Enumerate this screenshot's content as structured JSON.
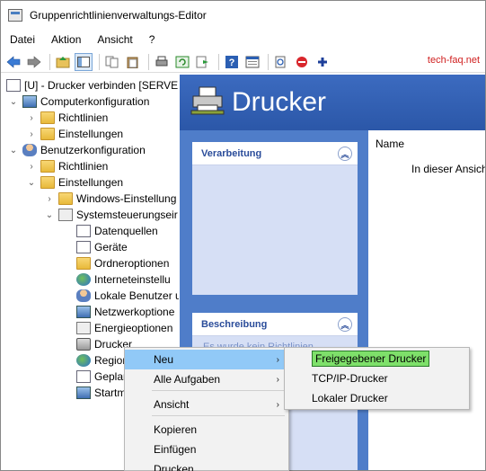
{
  "window": {
    "title": "Gruppenrichtlinienverwaltungs-Editor"
  },
  "menu": [
    "Datei",
    "Aktion",
    "Ansicht",
    "?"
  ],
  "toolbar": {
    "icons": [
      "back-arrow-icon",
      "forward-arrow-icon",
      "up-folder-icon",
      "show-hide-tree-icon",
      "copy-icon",
      "paste-icon",
      "print-icon",
      "refresh-icon",
      "export-icon",
      "help-icon",
      "properties-icon",
      "new-item-icon",
      "delete-icon",
      "add-icon"
    ],
    "watermark": "tech-faq.net"
  },
  "tree": {
    "items": [
      {
        "label": "[U] - Drucker verbinden [SERVER",
        "icon": "policy-doc-icon",
        "indent": 0,
        "chevron": ""
      },
      {
        "label": "Computerkonfiguration",
        "icon": "computer-config-icon",
        "indent": 1,
        "chevron": "open"
      },
      {
        "label": "Richtlinien",
        "icon": "folder-icon",
        "indent": 2,
        "chevron": "closed"
      },
      {
        "label": "Einstellungen",
        "icon": "folder-icon",
        "indent": 2,
        "chevron": "closed"
      },
      {
        "label": "Benutzerkonfiguration",
        "icon": "user-config-icon",
        "indent": 1,
        "chevron": "open"
      },
      {
        "label": "Richtlinien",
        "icon": "folder-icon",
        "indent": 2,
        "chevron": "closed"
      },
      {
        "label": "Einstellungen",
        "icon": "folder-icon",
        "indent": 2,
        "chevron": "open"
      },
      {
        "label": "Windows-Einstellung",
        "icon": "folder-icon",
        "indent": 3,
        "chevron": "closed"
      },
      {
        "label": "Systemsteuerungseir",
        "icon": "control-panel-icon",
        "indent": 3,
        "chevron": "open"
      },
      {
        "label": "Datenquellen",
        "icon": "datasource-icon",
        "indent": 4,
        "chevron": ""
      },
      {
        "label": "Geräte",
        "icon": "devices-icon",
        "indent": 4,
        "chevron": ""
      },
      {
        "label": "Ordneroptionen",
        "icon": "folder-options-icon",
        "indent": 4,
        "chevron": ""
      },
      {
        "label": "Interneteinstellu",
        "icon": "internet-settings-icon",
        "indent": 4,
        "chevron": ""
      },
      {
        "label": "Lokale Benutzer u",
        "icon": "local-users-icon",
        "indent": 4,
        "chevron": ""
      },
      {
        "label": "Netzwerkoptione",
        "icon": "network-options-icon",
        "indent": 4,
        "chevron": ""
      },
      {
        "label": "Energieoptionen",
        "icon": "power-options-icon",
        "indent": 4,
        "chevron": ""
      },
      {
        "label": "Drucker",
        "icon": "printer-icon",
        "indent": 4,
        "chevron": ""
      },
      {
        "label": "Region",
        "icon": "region-icon",
        "indent": 4,
        "chevron": ""
      },
      {
        "label": "Geplan",
        "icon": "scheduled-tasks-icon",
        "indent": 4,
        "chevron": ""
      },
      {
        "label": "Startm",
        "icon": "start-menu-icon",
        "indent": 4,
        "chevron": ""
      }
    ]
  },
  "right": {
    "banner_title": "Drucker",
    "section1_title": "Verarbeitung",
    "section2_title": "Beschreibung",
    "section2_faded": "Es wurde kein Richtlinien",
    "column_header": "Name",
    "info_text": "In dieser Ansich"
  },
  "context_menu": {
    "items": [
      {
        "label": "Neu",
        "submenu": true,
        "active": true
      },
      {
        "label": "Alle Aufgaben",
        "submenu": true,
        "active": false
      },
      {
        "label": "Ansicht",
        "submenu": true,
        "active": false
      },
      {
        "label": "Kopieren",
        "submenu": false,
        "active": false
      },
      {
        "label": "Einfügen",
        "submenu": false,
        "active": false
      },
      {
        "label": "Drucken",
        "submenu": false,
        "active": false
      }
    ]
  },
  "sub_menu": {
    "items": [
      {
        "label": "Freigegebener Drucker",
        "highlighted": true
      },
      {
        "label": "TCP/IP-Drucker",
        "highlighted": false
      },
      {
        "label": "Lokaler Drucker",
        "highlighted": false
      }
    ]
  }
}
